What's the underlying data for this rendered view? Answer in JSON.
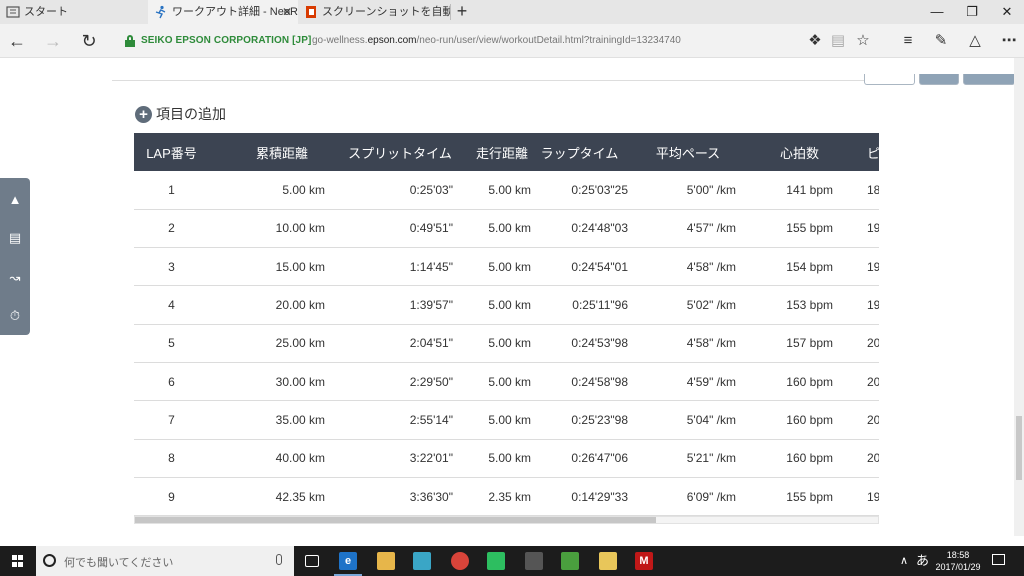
{
  "tabs": [
    {
      "label": "スタート"
    },
    {
      "label": "ワークアウト詳細 - NeoRu"
    },
    {
      "label": "スクリーンショットを自動的に Or"
    }
  ],
  "address": {
    "cert": "SEIKO EPSON CORPORATION [JP]",
    "url_pre": "go-wellness.",
    "url_domain": "epson.com",
    "url_post": "/neo-run/user/view/workoutDetail.html?trainingId=13234740"
  },
  "content": {
    "add_item_label": "項目の追加",
    "columns": [
      "LAP番号",
      "累積距離",
      "スプリットタイム",
      "走行距離",
      "ラップタイム",
      "平均ペース",
      "心拍数",
      "ピッ"
    ],
    "rows": [
      [
        "1",
        "5.00 km",
        "0:25'03\"",
        "5.00 km",
        "0:25'03\"25",
        "5'00\" /km",
        "141 bpm",
        "18"
      ],
      [
        "2",
        "10.00 km",
        "0:49'51\"",
        "5.00 km",
        "0:24'48\"03",
        "4'57\" /km",
        "155 bpm",
        "19"
      ],
      [
        "3",
        "15.00 km",
        "1:14'45\"",
        "5.00 km",
        "0:24'54\"01",
        "4'58\" /km",
        "154 bpm",
        "19"
      ],
      [
        "4",
        "20.00 km",
        "1:39'57\"",
        "5.00 km",
        "0:25'11\"96",
        "5'02\" /km",
        "153 bpm",
        "19"
      ],
      [
        "5",
        "25.00 km",
        "2:04'51\"",
        "5.00 km",
        "0:24'53\"98",
        "4'58\" /km",
        "157 bpm",
        "20"
      ],
      [
        "6",
        "30.00 km",
        "2:29'50\"",
        "5.00 km",
        "0:24'58\"98",
        "4'59\" /km",
        "160 bpm",
        "20"
      ],
      [
        "7",
        "35.00 km",
        "2:55'14\"",
        "5.00 km",
        "0:25'23\"98",
        "5'04\" /km",
        "160 bpm",
        "20"
      ],
      [
        "8",
        "40.00 km",
        "3:22'01\"",
        "5.00 km",
        "0:26'47\"06",
        "5'21\" /km",
        "160 bpm",
        "20"
      ],
      [
        "9",
        "42.35 km",
        "3:36'30\"",
        "2.35 km",
        "0:14'29\"33",
        "6'09\" /km",
        "155 bpm",
        "19"
      ]
    ]
  },
  "taskbar": {
    "search_placeholder": "何でも聞いてください",
    "ime": "あ",
    "time": "18:58",
    "date": "2017/01/29"
  },
  "colors": {
    "table_header": "#3c4452",
    "side_panel": "#6f7c8a",
    "secure_green": "#2e8b3a"
  }
}
